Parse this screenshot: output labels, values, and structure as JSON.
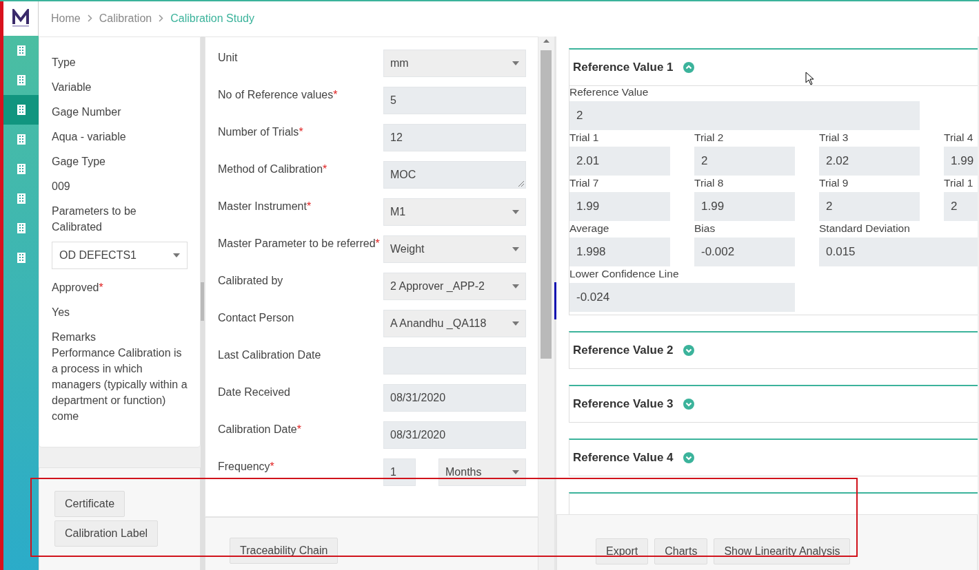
{
  "nav": {
    "items": [
      {
        "selected": false
      },
      {
        "selected": false
      },
      {
        "selected": true
      },
      {
        "selected": false
      },
      {
        "selected": false
      },
      {
        "selected": false
      },
      {
        "selected": false
      },
      {
        "selected": false
      }
    ]
  },
  "breadcrumb": [
    {
      "label": "Home",
      "current": false
    },
    {
      "label": "Calibration",
      "current": false
    },
    {
      "label": "Calibration Study",
      "current": true
    }
  ],
  "details": {
    "items": [
      {
        "kind": "text",
        "text": "Type"
      },
      {
        "kind": "text",
        "text": "Variable"
      },
      {
        "kind": "text",
        "text": "Gage Number"
      },
      {
        "kind": "text",
        "text": "Aqua - variable"
      },
      {
        "kind": "text",
        "text": "Gage Type"
      },
      {
        "kind": "text",
        "text": "009"
      },
      {
        "kind": "text",
        "text": "Parameters to be Calibrated"
      },
      {
        "kind": "select",
        "value": "OD DEFECTS1"
      },
      {
        "kind": "label",
        "text": "Approved",
        "required": true
      },
      {
        "kind": "text",
        "text": "Yes"
      },
      {
        "kind": "remarks",
        "label": "Remarks",
        "text": "Performance Calibration is a process in which managers (typically within a department or function) come"
      }
    ],
    "actions": [
      "Certificate",
      "Calibration Label"
    ]
  },
  "form": {
    "fields": [
      {
        "label": "Unit",
        "required": false,
        "kind": "select",
        "value": "mm"
      },
      {
        "label": "No of Reference values",
        "required": true,
        "kind": "input",
        "value": "5"
      },
      {
        "label": "Number of Trials",
        "required": true,
        "kind": "input",
        "value": "12"
      },
      {
        "label": "Method of Calibration",
        "required": true,
        "kind": "textarea",
        "value": "MOC"
      },
      {
        "label": "Master Instrument",
        "required": true,
        "kind": "select",
        "value": "M1"
      },
      {
        "label": "Master Parameter to be referred",
        "required": true,
        "kind": "select",
        "value": "Weight"
      },
      {
        "label": "Calibrated by",
        "required": false,
        "kind": "select",
        "value": "2 Approver _APP-2"
      },
      {
        "label": "Contact Person",
        "required": false,
        "kind": "select",
        "value": "A Anandhu _QA118"
      },
      {
        "label": "Last Calibration Date",
        "required": false,
        "kind": "input"
      },
      {
        "label": "Date Received",
        "required": false,
        "kind": "input",
        "value": "08/31/2020"
      },
      {
        "label": "Calibration Date",
        "required": true,
        "kind": "input",
        "value": "08/31/2020"
      },
      {
        "label": "Frequency",
        "required": true,
        "kind": "pair",
        "value": "1",
        "unit": "Months"
      }
    ],
    "actions": [
      "Traceability Chain"
    ]
  },
  "reference_values": [
    {
      "title": "Reference Value 1",
      "expanded": true,
      "rows": [
        [
          {
            "label": "Reference Value",
            "value": "2",
            "kind": "wide"
          }
        ],
        [
          {
            "label": "Trial 1",
            "value": "2.01",
            "kind": "single"
          },
          {
            "label": "Trial 2",
            "value": "2",
            "kind": "single"
          },
          {
            "label": "Trial 3",
            "value": "2.02",
            "kind": "single"
          },
          {
            "label": "Trial 4",
            "value": "1.99",
            "kind": "single"
          }
        ],
        [
          {
            "label": "Trial 7",
            "value": "1.99",
            "kind": "single"
          },
          {
            "label": "Trial 8",
            "value": "1.99",
            "kind": "single"
          },
          {
            "label": "Trial 9",
            "value": "2",
            "kind": "single"
          },
          {
            "label": "Trial 1",
            "value": "2",
            "kind": "single"
          }
        ],
        [
          {
            "label": "Average",
            "value": "1.998",
            "kind": "single"
          },
          {
            "label": "Bias",
            "value": "-0.002",
            "kind": "single"
          },
          {
            "label": "Standard Deviation",
            "value": "0.015",
            "kind": "double"
          }
        ],
        [
          {
            "label": "Lower Confidence Line",
            "value": "-0.024",
            "kind": "double"
          }
        ]
      ]
    },
    {
      "title": "Reference Value 2",
      "expanded": false
    },
    {
      "title": "Reference Value 3",
      "expanded": false
    },
    {
      "title": "Reference Value 4",
      "expanded": false
    }
  ],
  "results_actions": [
    "Export",
    "Charts",
    "Show Linearity Analysis"
  ],
  "required_mark": "*"
}
